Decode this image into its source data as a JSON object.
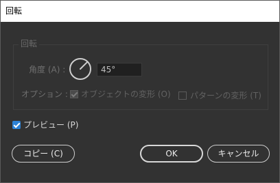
{
  "window": {
    "title": "回転"
  },
  "rotate_group": {
    "title": "回転",
    "angle_label": "角度 (A) :",
    "angle_value": "45°",
    "options_label": "オプション :",
    "transform_objects": {
      "label": "オブジェクトの変形 (O)",
      "checked": true,
      "enabled": false
    },
    "transform_patterns": {
      "label": "パターンの変形 (T)",
      "checked": false,
      "enabled": false
    }
  },
  "preview": {
    "label": "プレビュー (P)",
    "checked": true
  },
  "buttons": {
    "copy": "コピー (C)",
    "ok": "OK",
    "cancel": "キャンセル"
  },
  "colors": {
    "background": "#323232",
    "accent": "#2c82d6",
    "titlebar": "#ffffff"
  }
}
